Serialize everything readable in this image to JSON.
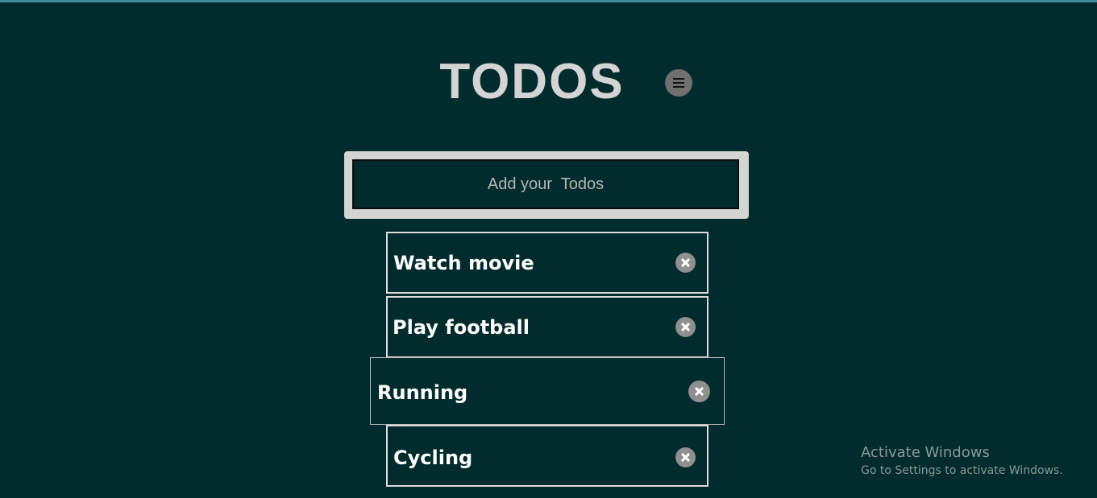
{
  "header": {
    "title": "TODOS",
    "menu_icon": "hamburger-menu-icon"
  },
  "input": {
    "placeholder": "Add your  Todos",
    "value": ""
  },
  "todos": [
    {
      "label": "Watch movie",
      "delete_icon": "close-circle-icon"
    },
    {
      "label": "Play football",
      "delete_icon": "close-circle-icon"
    },
    {
      "label": "Running",
      "delete_icon": "close-circle-icon"
    },
    {
      "label": "Cycling",
      "delete_icon": "close-circle-icon"
    }
  ],
  "watermark": {
    "title": "Activate Windows",
    "subtitle": "Go to Settings to activate Windows."
  },
  "colors": {
    "background": "#012b2c",
    "title": "#d4d4d4",
    "item_border": "#dcdcdc",
    "delete_button": "#8f8f8f",
    "top_accent": "#3e8e92"
  }
}
